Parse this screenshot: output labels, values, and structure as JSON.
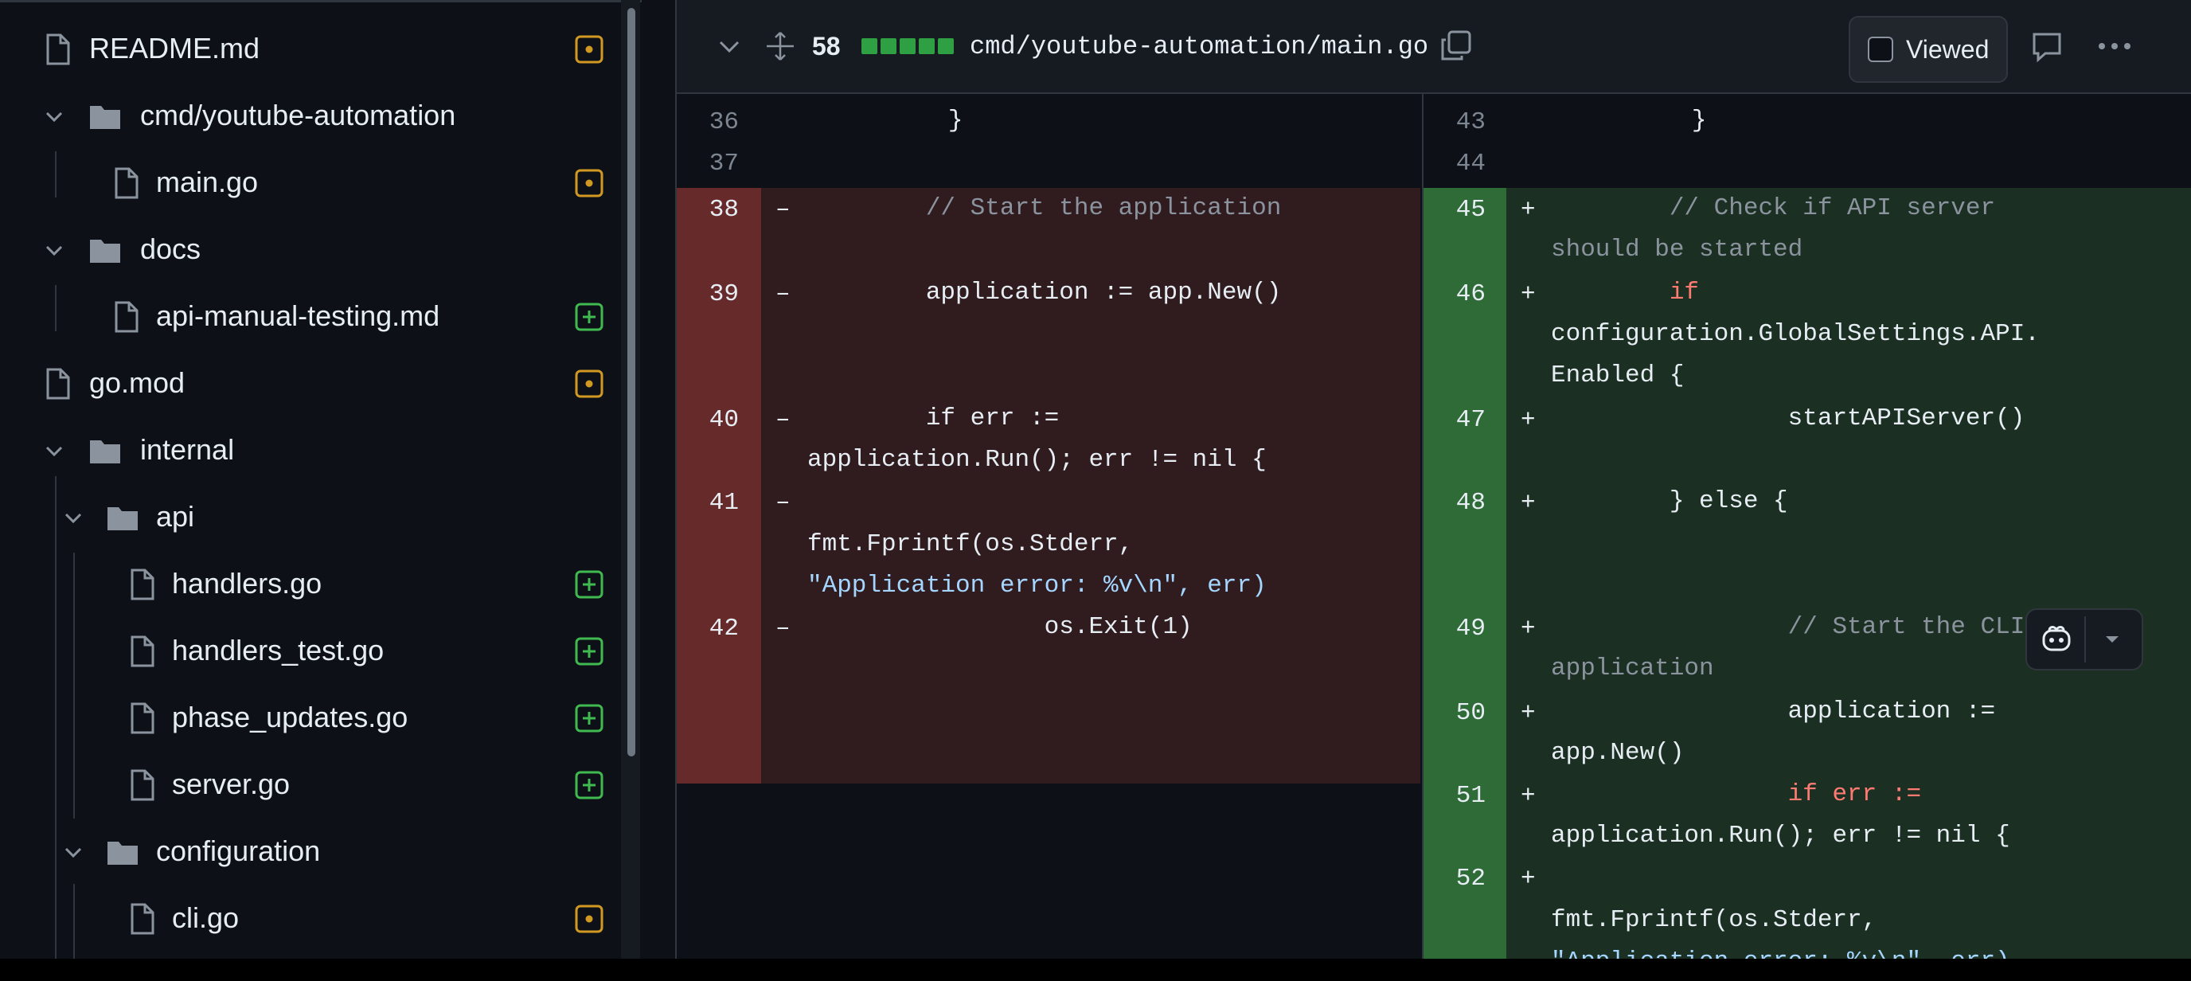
{
  "sidebar": {
    "items": [
      {
        "label": "README.md",
        "type": "file",
        "status": "modified"
      },
      {
        "label": "cmd/youtube-automation",
        "type": "folder"
      },
      {
        "label": "main.go",
        "type": "file",
        "status": "modified"
      },
      {
        "label": "docs",
        "type": "folder"
      },
      {
        "label": "api-manual-testing.md",
        "type": "file",
        "status": "added"
      },
      {
        "label": "go.mod",
        "type": "file",
        "status": "modified"
      },
      {
        "label": "internal",
        "type": "folder"
      },
      {
        "label": "api",
        "type": "folder"
      },
      {
        "label": "handlers.go",
        "type": "file",
        "status": "added"
      },
      {
        "label": "handlers_test.go",
        "type": "file",
        "status": "added"
      },
      {
        "label": "phase_updates.go",
        "type": "file",
        "status": "added"
      },
      {
        "label": "server.go",
        "type": "file",
        "status": "added"
      },
      {
        "label": "configuration",
        "type": "folder"
      },
      {
        "label": "cli.go",
        "type": "file",
        "status": "modified"
      }
    ]
  },
  "diff_header": {
    "change_count": "58",
    "file_path": "cmd/youtube-automation/main.go",
    "viewed_label": "Viewed",
    "icons": [
      "chevron-down-icon",
      "expand-icon",
      "copy-icon",
      "comment-icon",
      "kebab-icon"
    ]
  },
  "left": {
    "lines": [
      {
        "num": "36",
        "code": "        }"
      },
      {
        "num": "37",
        "code": ""
      },
      {
        "num": "38",
        "sign": "–",
        "code": "        // Start the application"
      },
      {
        "num": "39",
        "sign": "–",
        "code": "        application := app.New()"
      },
      {
        "num": "40",
        "sign": "–",
        "code_a": "        if err :=",
        "code_b": "application.Run(); err != nil {"
      },
      {
        "num": "41",
        "sign": "–",
        "code_a": "",
        "code_b": "fmt.Fprintf(os.Stderr,",
        "code_c": "\"Application error: %v\\n\", err)"
      },
      {
        "num": "42",
        "sign": "–",
        "code": "                os.Exit(1)"
      }
    ]
  },
  "right": {
    "lines": [
      {
        "num": "43",
        "code": "        }"
      },
      {
        "num": "44",
        "code": ""
      },
      {
        "num": "45",
        "sign": "+",
        "code_a": "        // Check if API server",
        "code_b": "should be started"
      },
      {
        "num": "46",
        "sign": "+",
        "code_a": "        if",
        "code_b": "configuration.GlobalSettings.API.",
        "code_c": "Enabled {"
      },
      {
        "num": "47",
        "sign": "+",
        "code": "                startAPIServer()"
      },
      {
        "num": "48",
        "sign": "+",
        "code": "        } else {"
      },
      {
        "num": "49",
        "sign": "+",
        "code_a": "                // Start the CLI",
        "code_b": "application"
      },
      {
        "num": "50",
        "sign": "+",
        "code_a": "                application :=",
        "code_b": "app.New()"
      },
      {
        "num": "51",
        "sign": "+",
        "code_a": "                if err :=",
        "code_b": "application.Run(); err != nil {"
      },
      {
        "num": "52",
        "sign": "+",
        "code_a": "",
        "code_b": "fmt.Fprintf(os.Stderr,",
        "code_c": "\"Application error: %v\\n\", err)"
      }
    ]
  },
  "colors": {
    "added": "#3fb950",
    "modified": "#d29922",
    "deleted_bg": "#301c1f",
    "added_bg": "#1b2f23"
  }
}
